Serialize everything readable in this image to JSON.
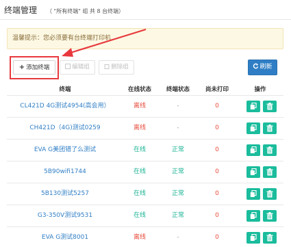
{
  "header": {
    "title": "终端管理",
    "subtitle": "（ \"所有终端\" 组 共 8 台终端）"
  },
  "alert": {
    "text": "温馨提示：您必须要有台终端打印机"
  },
  "toolbar": {
    "add_label": "添加终端",
    "edit_label": "编辑组",
    "delete_label": "删除组",
    "refresh_label": "刷新"
  },
  "table": {
    "headers": {
      "name": "终端",
      "online": "在线状态",
      "status": "终端状态",
      "pending": "尚未打印",
      "ops": "操作"
    },
    "rows": [
      {
        "name": "CL421D 4G测试4954(高会用）",
        "online": "离线",
        "status": "-",
        "pending": "0"
      },
      {
        "name": "CH421D（4G)测试0259",
        "online": "离线",
        "status": "-",
        "pending": "0"
      },
      {
        "name": "EVA G美团错了么测试",
        "online": "在线",
        "status": "正常",
        "pending": "0"
      },
      {
        "name": "5B90wifi1744",
        "online": "在线",
        "status": "正常",
        "pending": "0"
      },
      {
        "name": "5B130测试5257",
        "online": "在线",
        "status": "正常",
        "pending": "0"
      },
      {
        "name": "G3-350V测试9531",
        "online": "在线",
        "status": "正常",
        "pending": "0"
      },
      {
        "name": "EVA G测试8001",
        "online": "离线",
        "status": "-",
        "pending": "0"
      }
    ]
  },
  "colors": {
    "accent": "#2f7ec5",
    "offline": "#e74c3c",
    "online": "#1ab394",
    "op_button": "#1abc9c",
    "annotation": "#e8383d"
  }
}
